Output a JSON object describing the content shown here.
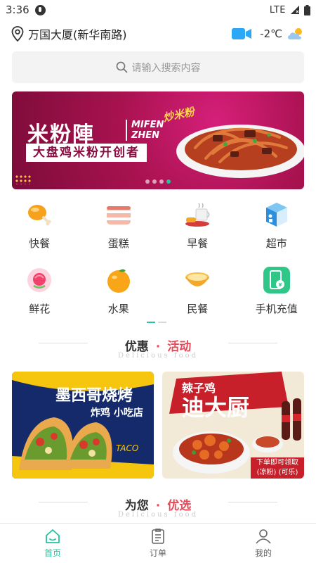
{
  "status_bar": {
    "time": "3:36",
    "network": "LTE"
  },
  "location": {
    "address": "万国大厦(新华南路)",
    "temperature": "-2℃"
  },
  "search": {
    "placeholder": "请输入搜索内容"
  },
  "banner": {
    "brand_cn": "米粉陣",
    "brand_en_line1": "MIFEN",
    "brand_en_line2": "ZHEN",
    "slogan": "大盘鸡米粉开创者",
    "script": "炒米粉",
    "slide_count": 4,
    "active_slide": 4
  },
  "categories": [
    {
      "label": "快餐",
      "icon": "drumstick-icon"
    },
    {
      "label": "蛋糕",
      "icon": "cake-icon"
    },
    {
      "label": "早餐",
      "icon": "breakfast-icon"
    },
    {
      "label": "超市",
      "icon": "supermarket-icon"
    },
    {
      "label": "鲜花",
      "icon": "flower-icon"
    },
    {
      "label": "水果",
      "icon": "orange-icon"
    },
    {
      "label": "民餐",
      "icon": "bowl-icon"
    },
    {
      "label": "手机充值",
      "icon": "phone-recharge-icon"
    }
  ],
  "section_deals": {
    "title_a": "优惠",
    "title_b": "活动",
    "subtitle": "Delicious food"
  },
  "promos": {
    "left": {
      "title": "墨西哥烧烤",
      "subtitle": "炸鸡 小吃店",
      "tag": "TACO"
    },
    "right": {
      "top": "辣子鸡",
      "title": "迪大厨",
      "note_line1": "下单即可领取",
      "note_line2": "(凉粉) (可乐)"
    }
  },
  "section_pick": {
    "title_a": "为您",
    "title_b": "优选",
    "subtitle": "Delicious food"
  },
  "tabs": [
    {
      "label": "首页",
      "active": true
    },
    {
      "label": "订单",
      "active": false
    },
    {
      "label": "我的",
      "active": false
    }
  ],
  "colors": {
    "accent": "#25c2a0",
    "highlight": "#e84a5a",
    "banner_bg": "#a8124f"
  }
}
